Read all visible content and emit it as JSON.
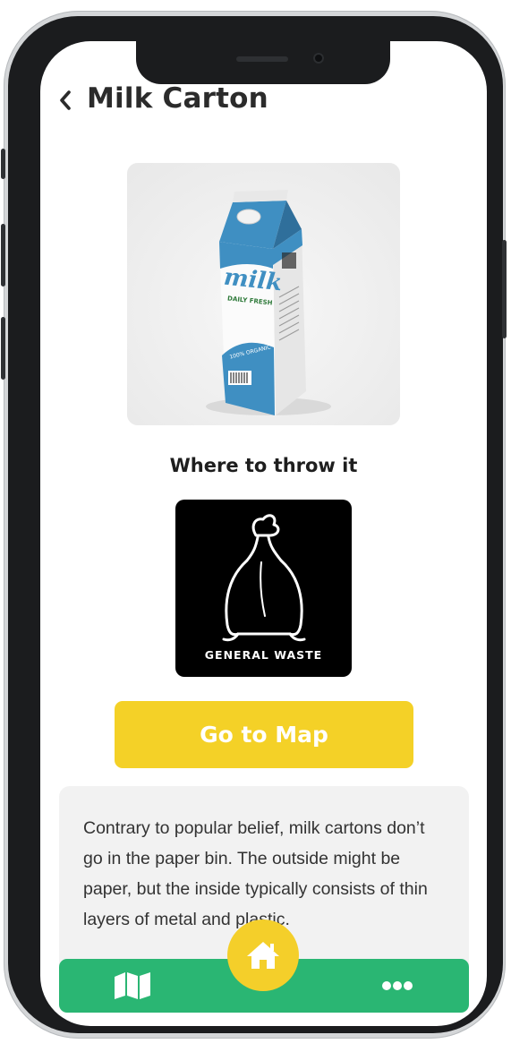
{
  "header": {
    "title": "Milk Carton"
  },
  "product": {
    "carton_brand": "milk",
    "carton_tagline": "DAILY FRESH",
    "carton_badge": "100% ORGANIC"
  },
  "disposal": {
    "heading": "Where to throw it",
    "bin_label": "GENERAL WASTE"
  },
  "actions": {
    "map_button_label": "Go to Map"
  },
  "info": {
    "text": "Contrary to popular belief, milk cartons don’t go in the paper bin. The outside might be paper, but the inside typically consists of thin layers of metal and plastic."
  },
  "nav": {
    "items": [
      "map-icon",
      "home-icon",
      "more-icon"
    ]
  },
  "colors": {
    "accent_yellow": "#f4d127",
    "nav_green": "#2ab673",
    "bin_black": "#000000",
    "carton_blue": "#3f8fc2"
  }
}
